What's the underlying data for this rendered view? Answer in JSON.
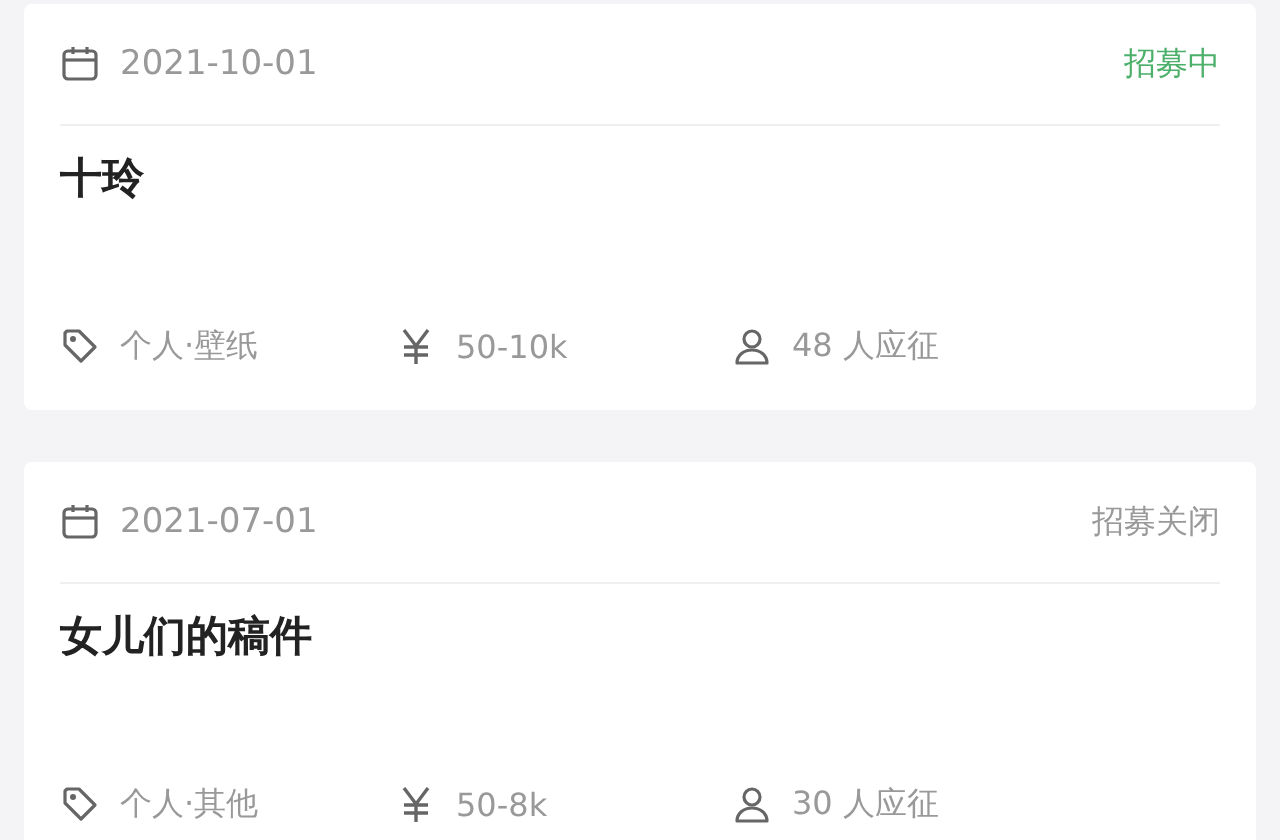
{
  "cards": [
    {
      "date": "2021-10-01",
      "status": {
        "text": "招募中",
        "open": true
      },
      "title": "十玲",
      "category": "个人·壁纸",
      "budget": "50-10k",
      "applicants": "48 人应征"
    },
    {
      "date": "2021-07-01",
      "status": {
        "text": "招募关闭",
        "open": false
      },
      "title": "女儿们的稿件",
      "category": "个人·其他",
      "budget": "50-8k",
      "applicants": "30 人应征"
    }
  ]
}
